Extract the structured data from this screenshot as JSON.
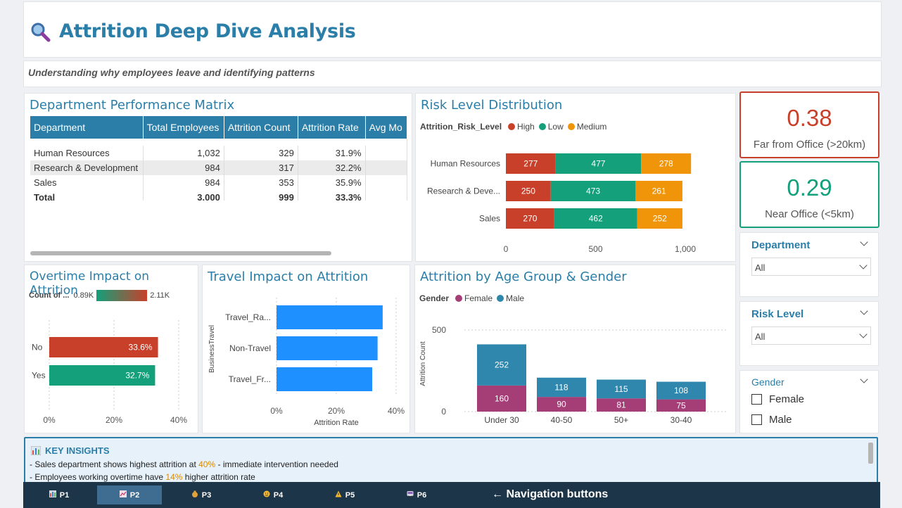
{
  "header": {
    "title": "Attrition Deep Dive Analysis",
    "subtitle": "Understanding why employees leave and identifying patterns"
  },
  "matrix": {
    "title": "Department Performance Matrix",
    "columns": [
      "Department",
      "Total Employees",
      "Attrition Count",
      "Attrition Rate",
      "Avg Mo"
    ],
    "rows": [
      [
        "Human Resources",
        "1,032",
        "329",
        "31.9%",
        ""
      ],
      [
        "Research & Development",
        "984",
        "317",
        "32.2%",
        ""
      ],
      [
        "Sales",
        "984",
        "353",
        "35.9%",
        ""
      ]
    ],
    "total": [
      "Total",
      "3,000",
      "999",
      "33.3%",
      ""
    ]
  },
  "kpis": [
    {
      "value": "0.38",
      "label": "Far from Office (>20km)",
      "color": "#c8402a"
    },
    {
      "value": "0.29",
      "label": "Near Office (<5km)",
      "color": "#13a07a"
    }
  ],
  "slicers": {
    "department": {
      "title": "Department",
      "value": "All"
    },
    "risk": {
      "title": "Risk Level",
      "value": "All"
    },
    "gender": {
      "title": "Gender",
      "options": [
        "Female",
        "Male"
      ]
    }
  },
  "insights": {
    "title": "KEY INSIGHTS",
    "line1_a": "- Sales department shows highest attrition at ",
    "line1_b": "40%",
    "line1_c": " - immediate intervention needed",
    "line2_a": "- Employees working overtime have ",
    "line2_b": "14%",
    "line2_c": " higher attrition rate"
  },
  "nav": {
    "buttons": [
      "P1",
      "P2",
      "P3",
      "P4",
      "P5",
      "P6"
    ],
    "active": 1,
    "hint": "← Navigation buttons"
  },
  "colors": {
    "accent": "#2a7ea8",
    "high": "#c8402a",
    "low": "#13a07a",
    "medium": "#f0950a",
    "female": "#a53d77",
    "male": "#2f87ad",
    "travel": "#1e90ff"
  },
  "chart_data": [
    {
      "type": "bar",
      "orientation": "horizontal",
      "stacked": true,
      "title": "Risk Level Distribution",
      "legend_title": "Attrition_Risk_Level",
      "categories": [
        "Human Resources",
        "Research & Deve...",
        "Sales"
      ],
      "series": [
        {
          "name": "High",
          "values": [
            277,
            250,
            270
          ]
        },
        {
          "name": "Low",
          "values": [
            477,
            473,
            462
          ]
        },
        {
          "name": "Medium",
          "values": [
            278,
            261,
            252
          ]
        }
      ],
      "xlim": [
        0,
        1200
      ],
      "xticks": [
        "0",
        "500",
        "1,000"
      ]
    },
    {
      "type": "bar",
      "orientation": "horizontal",
      "title": "Overtime Impact on Attrition",
      "legend_title": "Count of ...",
      "legend_min": "0.89K",
      "legend_max": "2.11K",
      "categories": [
        "No",
        "Yes"
      ],
      "values": [
        33.6,
        32.7
      ],
      "labels": [
        "33.6%",
        "32.7%"
      ],
      "xlim": [
        0,
        45
      ],
      "xticks": [
        "0%",
        "20%",
        "40%"
      ]
    },
    {
      "type": "bar",
      "orientation": "horizontal",
      "title": "Travel Impact on Attrition",
      "ylabel": "BusinessTravel",
      "xlabel": "Attrition Rate",
      "categories": [
        "Travel_Ra...",
        "Non-Travel",
        "Travel_Fr..."
      ],
      "values": [
        35.5,
        33.8,
        32.0
      ],
      "xlim": [
        0,
        40
      ],
      "xticks": [
        "0%",
        "20%",
        "40%"
      ]
    },
    {
      "type": "bar",
      "stacked": true,
      "title": "Attrition by Age Group & Gender",
      "legend_title": "Gender",
      "ylabel": "Attrition Count",
      "categories": [
        "Under 30",
        "40-50",
        "50+",
        "30-40"
      ],
      "series": [
        {
          "name": "Female",
          "values": [
            160,
            90,
            81,
            75
          ]
        },
        {
          "name": "Male",
          "values": [
            252,
            118,
            115,
            108
          ]
        }
      ],
      "ylim": [
        0,
        500
      ],
      "yticks": [
        "0",
        "500"
      ]
    }
  ]
}
